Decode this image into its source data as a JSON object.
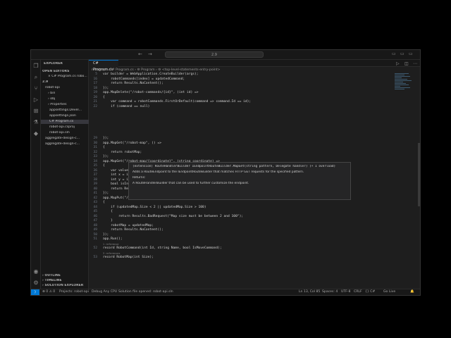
{
  "titlebar": {
    "search_text": "2.9",
    "back": "←",
    "forward": "→"
  },
  "sidebar": {
    "title": "EXPLORER",
    "open_editors_header": "OPEN EDITORS",
    "open_editor_item": "× C# Program.cs robo...",
    "folder_header": "2.9",
    "items": [
      "robot-api",
      "› bin",
      "› obj",
      "› Properties",
      "appsettings.Devel...",
      "appsettings.json",
      "C# Program.cs",
      "robot-api.csproj",
      "robot-api.sln",
      "aggregate-design-c...",
      "aggregate-design-c..."
    ],
    "outline": "› OUTLINE",
    "timeline": "› TIMELINE",
    "solution_explorer": "› SOLUTION EXPLORER"
  },
  "editor": {
    "tab_label": "C# Program.cs",
    "breadcrumb": "robot-api  ›  C# Program.cs  ›  ⚙ Program  ›  ⚙ <top-level-statements-entry-point>",
    "lines": [
      {
        "n": "5",
        "t": "var builder = WebApplication.CreateBuilder(args);"
      },
      {
        "n": "16",
        "t": "    robotCommands[index] = updatedCommand;"
      },
      {
        "n": "17",
        "t": "    return Results.NoContent();"
      },
      {
        "n": "18",
        "t": "});"
      },
      {
        "n": "19",
        "t": "app.MapDelete(\"/robot-commands/{id}\", (int id) =>"
      },
      {
        "n": "20",
        "t": "{"
      },
      {
        "n": "21",
        "t": "    var command = robotCommands.FirstOrDefault(command => command.Id == id);"
      },
      {
        "n": "22",
        "t": "    if (command == null)"
      },
      {
        "n": "",
        "t": ""
      },
      {
        "n": "",
        "t": ""
      },
      {
        "n": "",
        "t": ""
      },
      {
        "n": "",
        "t": ""
      },
      {
        "n": "",
        "t": ""
      },
      {
        "n": "",
        "t": ""
      },
      {
        "n": "29",
        "t": "});"
      },
      {
        "n": "30",
        "t": "app.MapGet(\"/robot-map\", () =>"
      },
      {
        "n": "31",
        "t": "{"
      },
      {
        "n": "32",
        "t": "    return robotMap;"
      },
      {
        "n": "33",
        "t": "});"
      },
      {
        "n": "34",
        "t": "app.MapGet(\"/robot-map/{coordinate}\", (string coordinate) =>"
      },
      {
        "n": "35",
        "t": "{"
      },
      {
        "n": "36",
        "t": "    var values = coordinate.Split(\"-\");"
      },
      {
        "n": "37",
        "t": "    int x = int.Parse(values[0]);"
      },
      {
        "n": "38",
        "t": "    int y = int.Parse(values[1]);"
      },
      {
        "n": "39",
        "t": "    bool isInsideMap = x >= 0 && y >= 0 && x < robotMap.Size && y < robotMap.Size;"
      },
      {
        "n": "40",
        "t": "    return Results.Ok(isInsideMap);"
      },
      {
        "n": "41",
        "t": "});"
      },
      {
        "n": "42",
        "t": "app.MapPut(\"/robot-map\", (RobotMap updatedMap) =>"
      },
      {
        "n": "43",
        "t": "{"
      },
      {
        "n": "44",
        "t": "    if (updatedMap.Size < 2 || updatedMap.Size > 100)"
      },
      {
        "n": "45",
        "t": "    {"
      },
      {
        "n": "46",
        "t": "        return Results.BadRequest(\"Map size must be between 2 and 100\");"
      },
      {
        "n": "47",
        "t": "    }"
      },
      {
        "n": "48",
        "t": "    robotMap = updatedMap;"
      },
      {
        "n": "49",
        "t": "    return Results.NoContent();"
      },
      {
        "n": "50",
        "t": "});"
      },
      {
        "n": "51",
        "t": "app.Run();"
      },
      {
        "n": "",
        "t": "1 reference",
        "lens": true
      },
      {
        "n": "52",
        "t": "record RobotCommand(int Id, string Name, bool IsMoveCommand);"
      },
      {
        "n": "",
        "t": "3 references",
        "lens": true
      },
      {
        "n": "53",
        "t": "record RobotMap(int Size);"
      }
    ],
    "hover": {
      "signature": "(extension) RouteHandlerBuilder IEndpointRouteBuilder.MapGet(string pattern, Delegate handler) (+ 1 overload)",
      "desc": "Adds a RouteEndpoint to the IEndpointRouteBuilder that matches HTTP GET requests for the specified pattern.",
      "returns_label": "Returns:",
      "returns_text": "A RouteHandlerBuilder that can be used to further customize the endpoint."
    }
  },
  "statusbar": {
    "errors": "⊗ 0 ⚠ 0",
    "projects": "Projects: robot-api",
    "config": "Debug Any CPU",
    "solution": "Solution file opened: robot-api.sln",
    "position": "Ln 13, Col 85",
    "spaces": "Spaces: 4",
    "encoding": "UTF-8",
    "eol": "CRLF",
    "language": "{} C#",
    "golive": "Go Live"
  }
}
